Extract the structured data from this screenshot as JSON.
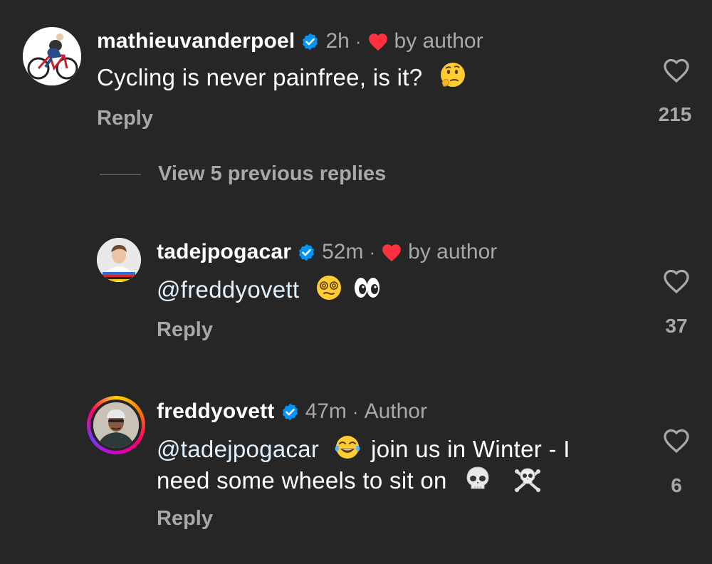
{
  "comments": [
    {
      "username": "mathieuvanderpoel",
      "time": "2h",
      "liked_by": "by author",
      "text": "Cycling is never painfree, is it?",
      "reply_label": "Reply",
      "likes": "215"
    },
    {
      "username": "tadejpogacar",
      "time": "52m",
      "liked_by": "by author",
      "mention": "@freddyovett",
      "reply_label": "Reply",
      "likes": "37"
    },
    {
      "username": "freddyovett",
      "time": "47m",
      "author_label": "Author",
      "mention": "@tadejpogacar",
      "text_line1": "join us in Winter - I",
      "text_line2": "need some wheels to sit on",
      "reply_label": "Reply",
      "likes": "6"
    }
  ],
  "view_replies_label": "View 5 previous replies",
  "separator": "·",
  "colors": {
    "background": "#262626",
    "secondary_text": "#a8a8a8",
    "verified_blue": "#0095f6",
    "heart_red": "#ff3040",
    "mention": "#e0f1ff"
  },
  "icons": {
    "verified": "verified-badge-icon",
    "liked_by_author": "red-heart-icon",
    "like": "heart-outline-icon",
    "emoji_thinking": "thinking-face-emoji",
    "emoji_dizzy": "face-with-spiral-eyes-emoji",
    "emoji_eyes": "eyes-emoji",
    "emoji_laughing": "face-with-tears-of-joy-emoji",
    "emoji_skull": "skull-emoji",
    "emoji_crossbones": "skull-and-crossbones-emoji"
  }
}
